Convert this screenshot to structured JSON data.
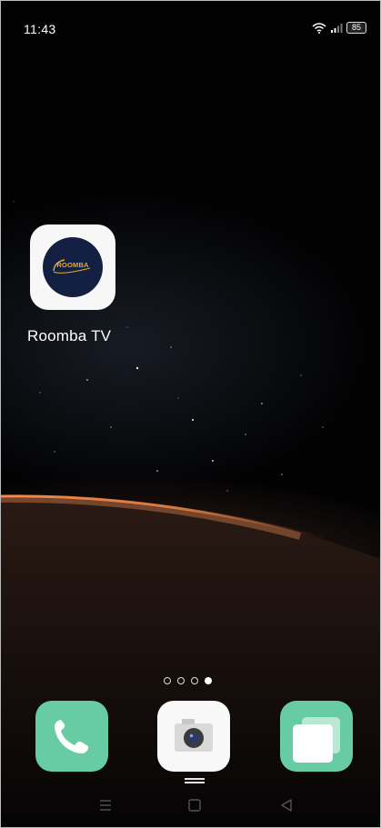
{
  "status_bar": {
    "time": "11:43",
    "battery": "85"
  },
  "home_screen": {
    "apps": [
      {
        "label": "Roomba TV",
        "icon": "roomba-tv-icon",
        "logo_text": "ROOMBA"
      }
    ],
    "page_indicator": {
      "pages": 4,
      "active": 4
    }
  },
  "dock": [
    {
      "icon": "phone-icon"
    },
    {
      "icon": "camera-icon"
    },
    {
      "icon": "recent-apps-icon"
    }
  ],
  "nav_bar": [
    "menu-icon",
    "home-icon",
    "back-icon"
  ],
  "colors": {
    "dock_green": "#67cba3",
    "roomba_navy": "#142042",
    "roomba_gold": "#e8a92a"
  }
}
